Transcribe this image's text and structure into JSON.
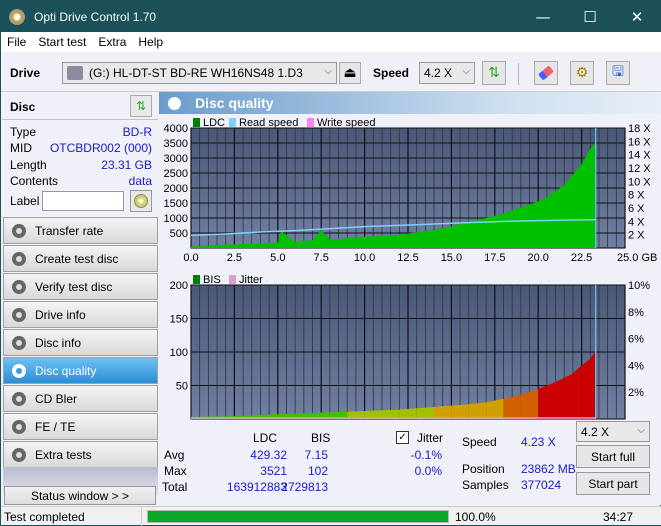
{
  "window": {
    "title": "Opti Drive Control 1.70",
    "minimize": "—",
    "maximize": "☐",
    "close": "✕"
  },
  "menu": [
    "File",
    "Start test",
    "Extra",
    "Help"
  ],
  "toolbar": {
    "drive_label": "Drive",
    "drive_value": "(G:)  HL-DT-ST BD-RE  WH16NS48 1.D3",
    "speed_label": "Speed",
    "speed_value": "4.2 X",
    "icons": [
      "eject-icon",
      "refresh-icon",
      "erase-icon",
      "settings-icon",
      "save-icon"
    ]
  },
  "disc": {
    "header": "Disc",
    "rows": [
      {
        "key": "Type",
        "value": "BD-R"
      },
      {
        "key": "MID",
        "value": "OTCBDR002 (000)"
      },
      {
        "key": "Length",
        "value": "23.31 GB"
      },
      {
        "key": "Contents",
        "value": "data"
      }
    ],
    "label_key": "Label",
    "label_value": ""
  },
  "nav": [
    {
      "label": "Transfer rate",
      "active": false
    },
    {
      "label": "Create test disc",
      "active": false
    },
    {
      "label": "Verify test disc",
      "active": false
    },
    {
      "label": "Drive info",
      "active": false
    },
    {
      "label": "Disc info",
      "active": false
    },
    {
      "label": "Disc quality",
      "active": true
    },
    {
      "label": "CD Bler",
      "active": false
    },
    {
      "label": "FE / TE",
      "active": false
    },
    {
      "label": "Extra tests",
      "active": false
    }
  ],
  "status_window_button": "Status window > >",
  "panel_title": "Disc quality",
  "chart_data": [
    {
      "type": "area",
      "title": "LDC chart",
      "legend": [
        "LDC",
        "Read speed",
        "Write speed"
      ],
      "legend_colors": [
        "#008000",
        "#80d0ff",
        "#ff80ff"
      ],
      "legend_placement": "top-left",
      "xlabel": "GB",
      "xlim": [
        0,
        25
      ],
      "x_ticks": [
        "0.0",
        "2.5",
        "5.0",
        "7.5",
        "10.0",
        "12.5",
        "15.0",
        "17.5",
        "20.0",
        "22.5",
        "25.0 GB"
      ],
      "ylim": [
        0,
        4000
      ],
      "y_ticks": [
        "4000",
        "3500",
        "3000",
        "2500",
        "2000",
        "1500",
        "1000",
        "500"
      ],
      "y2lim": [
        0,
        18
      ],
      "y2_ticks": [
        "18 X",
        "16 X",
        "14 X",
        "12 X",
        "10 X",
        "8 X",
        "6 X",
        "4 X",
        "2 X"
      ],
      "grid": true,
      "series": [
        {
          "name": "LDC",
          "x": [
            0,
            0.5,
            1,
            2,
            3,
            4,
            5,
            5.2,
            6,
            7,
            7.5,
            8,
            9,
            10,
            11,
            12,
            13,
            14,
            15,
            16,
            17,
            18,
            19,
            20,
            20.5,
            21,
            21.5,
            22,
            22.5,
            23,
            23.31
          ],
          "values": [
            40,
            60,
            80,
            110,
            130,
            150,
            180,
            560,
            200,
            260,
            600,
            280,
            330,
            370,
            410,
            450,
            520,
            600,
            720,
            870,
            1000,
            1150,
            1350,
            1550,
            1700,
            1900,
            2100,
            2450,
            2800,
            3300,
            3521
          ]
        },
        {
          "name": "Read speed",
          "x": [
            0,
            2,
            4,
            6,
            8,
            10,
            12,
            14,
            16,
            18,
            20,
            22,
            23.31
          ],
          "values": [
            1.9,
            2.1,
            2.4,
            2.6,
            2.9,
            3.2,
            3.4,
            3.6,
            3.8,
            4.0,
            4.1,
            4.2,
            4.23
          ]
        }
      ],
      "end_marker_x": 23.31
    },
    {
      "type": "bar",
      "title": "BIS chart",
      "legend": [
        "BIS",
        "Jitter"
      ],
      "legend_colors": [
        "#008000",
        "#d8a0d8"
      ],
      "legend_placement": "top-left",
      "xlabel": "GB",
      "xlim": [
        0,
        25
      ],
      "x_ticks": [
        "0.0",
        "2.5",
        "5.0",
        "7.5",
        "10.0",
        "12.5",
        "15.0",
        "17.5",
        "20.0",
        "22.5",
        "25.0 GB"
      ],
      "ylim": [
        0,
        200
      ],
      "y_ticks": [
        "200",
        "150",
        "100",
        "50"
      ],
      "y2lim": [
        0,
        10
      ],
      "y2_ticks": [
        "10%",
        "8%",
        "6%",
        "4%",
        "2%"
      ],
      "grid": true,
      "series": [
        {
          "name": "BIS",
          "x": [
            0,
            1,
            2,
            3,
            4,
            5,
            6,
            7,
            8,
            9,
            10,
            11,
            12,
            13,
            14,
            15,
            16,
            17,
            18,
            19,
            20,
            21,
            22,
            22.5,
            23,
            23.31
          ],
          "values": [
            3,
            4,
            4,
            5,
            6,
            7,
            8,
            9,
            10,
            11,
            12,
            13,
            14,
            16,
            18,
            20,
            22,
            25,
            30,
            36,
            45,
            55,
            68,
            80,
            90,
            102
          ]
        }
      ],
      "end_marker_x": 23.31
    }
  ],
  "stats": {
    "col_ldc": "LDC",
    "col_bis": "BIS",
    "rows": [
      {
        "label": "Avg",
        "ldc": "429.32",
        "bis": "7.15",
        "jitter": "-0.1%"
      },
      {
        "label": "Max",
        "ldc": "3521",
        "bis": "102",
        "jitter": "0.0%"
      },
      {
        "label": "Total",
        "ldc": "163912883",
        "bis": "2729813"
      }
    ],
    "jitter_label": "Jitter",
    "jitter_checked": true,
    "speed_label": "Speed",
    "speed_value": "4.23 X",
    "position_label": "Position",
    "position_value": "23862 MB",
    "samples_label": "Samples",
    "samples_value": "377024",
    "speed_select": "4.2 X",
    "start_full": "Start full",
    "start_part": "Start part"
  },
  "statusbar": {
    "text": "Test completed",
    "progress_percent": 100,
    "progress_label": "100.0%",
    "time": "34:27"
  }
}
